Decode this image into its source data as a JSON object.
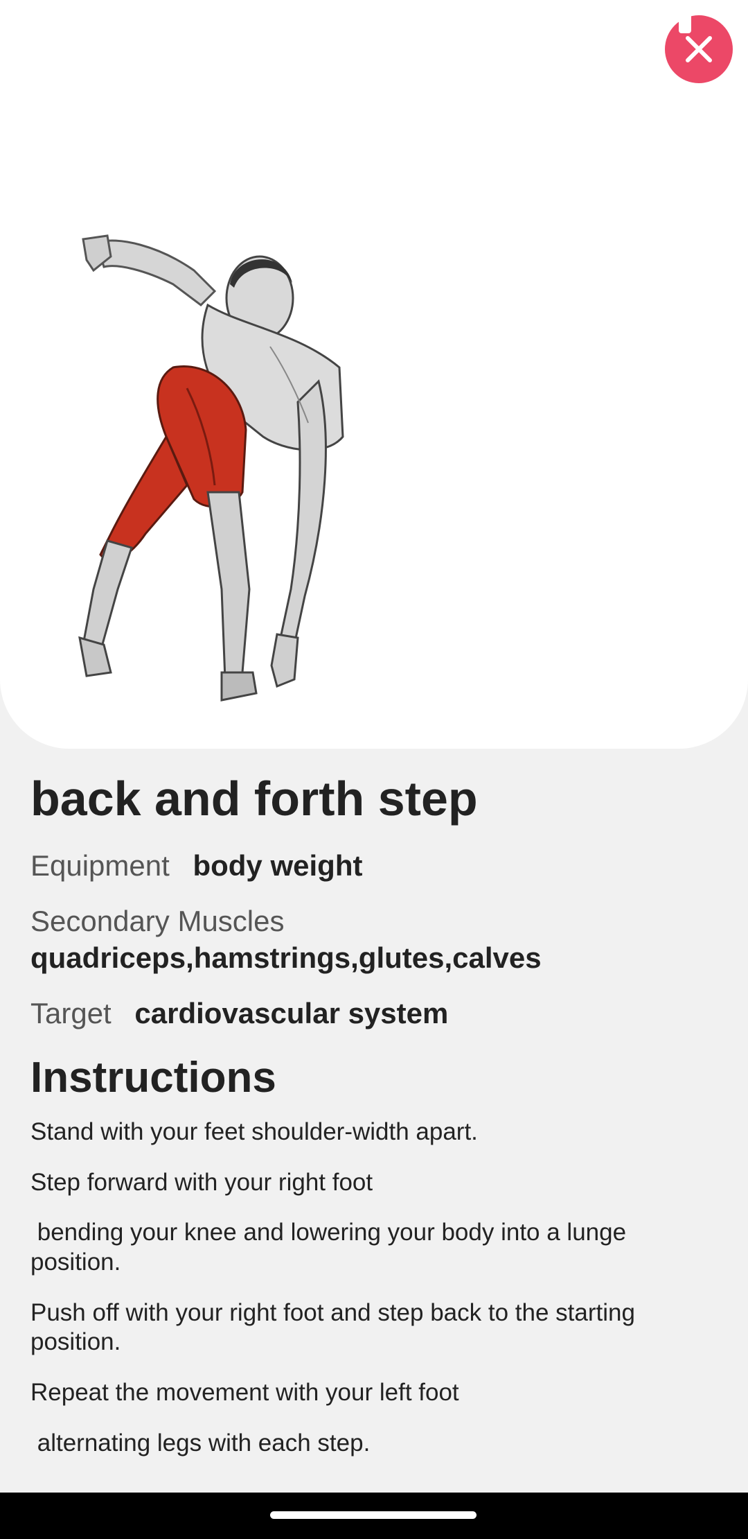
{
  "exercise": {
    "name": "back and forth step",
    "equipment_label": "Equipment",
    "equipment_value": "body weight",
    "secondary_label": "Secondary Muscles",
    "secondary_value": "quadriceps,hamstrings,glutes,calves",
    "target_label": "Target",
    "target_value": "cardiovascular system"
  },
  "instructions": {
    "title": "Instructions",
    "steps": [
      "Stand with your feet shoulder-width apart.",
      "Step forward with your right foot",
      " bending your knee and lowering your body into a lunge position.",
      "Push off with your right foot and step back to the starting position.",
      "Repeat the movement with your left foot",
      " alternating legs with each step."
    ]
  },
  "icons": {
    "close": "close-icon",
    "figure": "exercise-illustration"
  },
  "colors": {
    "accent": "#ec4867",
    "muscle_highlight": "#c8321f",
    "background": "#f1f1f1"
  }
}
